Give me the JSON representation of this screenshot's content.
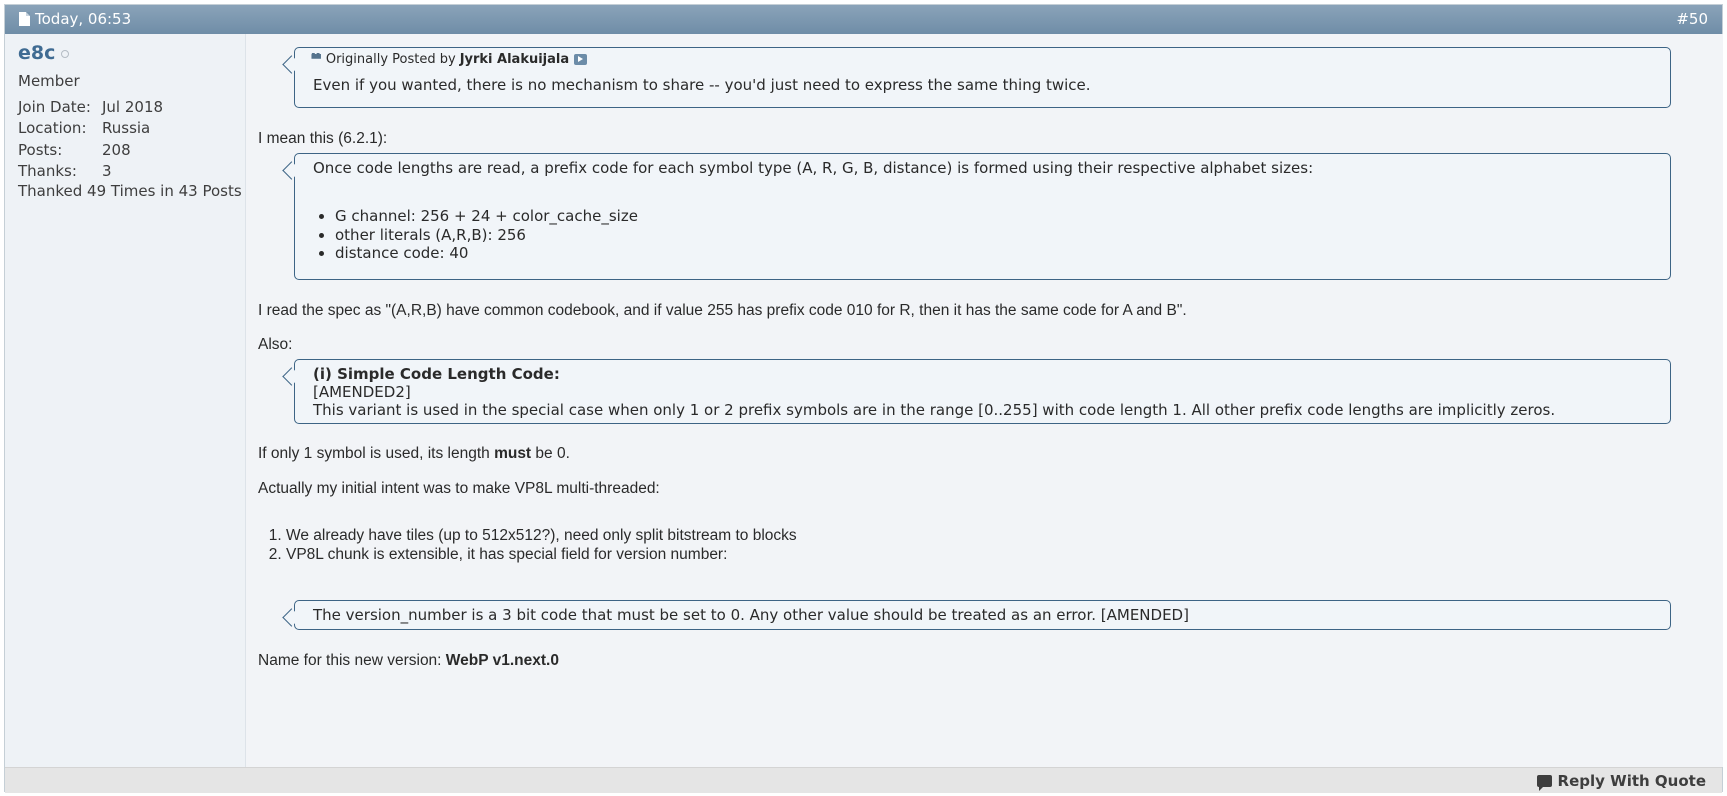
{
  "header": {
    "date": "Today, 06:53",
    "post_number": "#50"
  },
  "user": {
    "name": "e8c",
    "title": "Member",
    "stats": [
      {
        "label": "Join Date:",
        "value": "Jul 2018"
      },
      {
        "label": "Location:",
        "value": "Russia"
      },
      {
        "label": "Posts:",
        "value": "208"
      },
      {
        "label": "Thanks:",
        "value": "3"
      }
    ],
    "thanked": "Thanked 49 Times in 43 Posts"
  },
  "quote1": {
    "prefix": "Originally Posted by",
    "author": "Jyrki Alakuijala",
    "text": "Even if you wanted, there is no mechanism to share -- you'd just need to express the same thing twice."
  },
  "p1": "I mean this (6.2.1):",
  "quote2": {
    "text": "Once code lengths are read, a prefix code for each symbol type (A, R, G, B, distance) is formed using their respective alphabet sizes:",
    "items": [
      "G channel: 256 + 24 + color_cache_size",
      "other literals (A,R,B): 256",
      "distance code: 40"
    ]
  },
  "p2": "I read the spec as \"(A,R,B) have common codebook, and if value 255 has prefix code 010 for R, then it has the same code for A and B\".",
  "p3": "Also:",
  "quote3": {
    "heading": "(i) Simple Code Length Code:",
    "line2": "[AMENDED2]",
    "line3": "This variant is used in the special case when only 1 or 2 prefix symbols are in the range [0..255] with code length 1. All other prefix code lengths are implicitly zeros."
  },
  "p4": {
    "before": "If only 1 symbol is used, its length ",
    "bold": "must",
    "after": " be 0."
  },
  "p5": "Actually my initial intent was to make VP8L multi-threaded:",
  "list": [
    "We already have tiles (up to 512x512?), need only split bitstream to blocks",
    "VP8L chunk is extensible, it has special field for version number:"
  ],
  "quote4": {
    "text": "The version_number is a 3 bit code that must be set to 0. Any other value should be treated as an error. [AMENDED]"
  },
  "p6": {
    "before": "Name for this new version: ",
    "bold": "WebP v1.next.0"
  },
  "footer": {
    "reply_label": "Reply With Quote"
  }
}
